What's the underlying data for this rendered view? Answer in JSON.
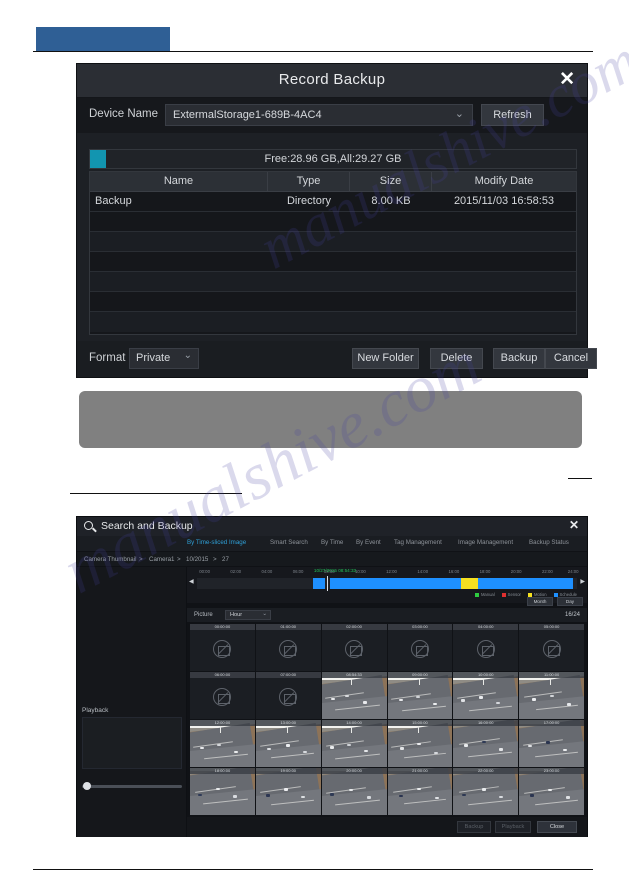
{
  "page": {
    "header_tab_color": "#2f5f95"
  },
  "dialog": {
    "title": "Record Backup",
    "close_icon": "close-icon",
    "device_label": "Device Name",
    "device_value": "ExtermalStorage1-689B-4AC4",
    "refresh_label": "Refresh",
    "capacity_text": "Free:28.96 GB,All:29.27 GB",
    "capacity_fill_color": "#1295b0",
    "columns": [
      "Name",
      "Type",
      "Size",
      "Modify Date"
    ],
    "rows": [
      {
        "name": "Backup",
        "type": "Directory",
        "size": "8.00 KB",
        "date": "2015/11/03 16:58:53"
      }
    ],
    "format_label": "Format",
    "format_value": "Private",
    "buttons": {
      "new_folder": "New Folder",
      "delete": "Delete",
      "backup": "Backup",
      "cancel": "Cancel"
    }
  },
  "search_backup": {
    "title": "Search and Backup",
    "search_icon": "search-icon",
    "close_icon": "close-icon",
    "tabs": [
      {
        "label": "By Time-sliced Image",
        "active": true
      },
      {
        "label": "Smart Search",
        "active": false
      },
      {
        "label": "By Time",
        "active": false
      },
      {
        "label": "By Event",
        "active": false
      },
      {
        "label": "Tag Management",
        "active": false
      },
      {
        "label": "Image Management",
        "active": false
      },
      {
        "label": "Backup Status",
        "active": false
      }
    ],
    "breadcrumb": [
      "Camera Thumbnail",
      "Camera1",
      "10/2015",
      "27"
    ],
    "timeline": {
      "stamp": "10/27/2015 08:54:33",
      "ticks": [
        "00:00",
        "02:00",
        "04:00",
        "06:00",
        "08:00",
        "10:00",
        "12:00",
        "14:00",
        "16:00",
        "18:00",
        "20:00",
        "22:00",
        "24:00"
      ],
      "legend": [
        {
          "label": "Manual",
          "color": "#2ecc40"
        },
        {
          "label": "Sensor",
          "color": "#e03030"
        },
        {
          "label": "Motion",
          "color": "#f5e020"
        },
        {
          "label": "Schedule",
          "color": "#1e90ff"
        }
      ],
      "buttons": {
        "left": "Month",
        "right": "Day"
      }
    },
    "picture": {
      "label": "Picture",
      "mode": "Hour",
      "count": "16/24"
    },
    "thumbnails": [
      {
        "time": "00:00:00",
        "has_image": false
      },
      {
        "time": "01:00:00",
        "has_image": false
      },
      {
        "time": "02:00:00",
        "has_image": false
      },
      {
        "time": "03:00:00",
        "has_image": false
      },
      {
        "time": "04:00:00",
        "has_image": false
      },
      {
        "time": "05:00:00",
        "has_image": false
      },
      {
        "time": "06:00:00",
        "has_image": false
      },
      {
        "time": "07:00:00",
        "has_image": false
      },
      {
        "time": "08:54:33",
        "has_image": true
      },
      {
        "time": "09:00:00",
        "has_image": true
      },
      {
        "time": "10:00:00",
        "has_image": true
      },
      {
        "time": "11:00:00",
        "has_image": true
      },
      {
        "time": "12:00:00",
        "has_image": true
      },
      {
        "time": "13:00:00",
        "has_image": true
      },
      {
        "time": "14:00:00",
        "has_image": true
      },
      {
        "time": "15:00:00",
        "has_image": true
      },
      {
        "time": "16:00:00",
        "has_image": true
      },
      {
        "time": "17:00:00",
        "has_image": true
      },
      {
        "time": "18:00:00",
        "has_image": true
      },
      {
        "time": "19:00:00",
        "has_image": true
      },
      {
        "time": "20:00:00",
        "has_image": true
      },
      {
        "time": "21:00:00",
        "has_image": true
      },
      {
        "time": "22:00:00",
        "has_image": true
      },
      {
        "time": "23:00:00",
        "has_image": true
      }
    ],
    "playback_label": "Playback",
    "footer_buttons": {
      "backup": "Backup",
      "playback": "Playback",
      "close": "Close"
    }
  },
  "watermark": {
    "line1": "manualshive.com",
    "line2": ""
  }
}
